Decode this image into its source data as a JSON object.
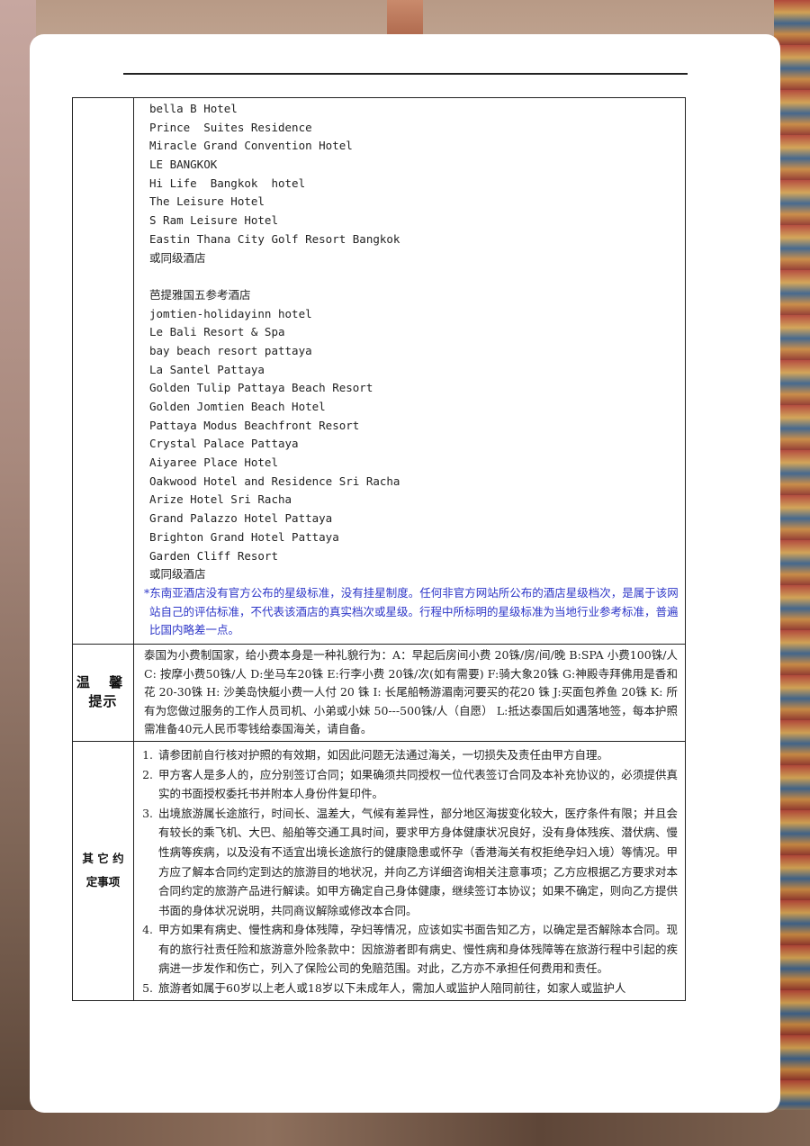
{
  "hotels_group1": [
    "bella B Hotel",
    "Prince  Suites Residence",
    "Miracle Grand Convention Hotel",
    "LE BANGKOK",
    "Hi Life  Bangkok  hotel",
    "The Leisure Hotel",
    "S Ram Leisure Hotel",
    "Eastin Thana City Golf Resort Bangkok",
    "或同级酒店"
  ],
  "pattaya_heading": "芭提雅国五参考酒店",
  "hotels_group2": [
    "jomtien-holidayinn hotel",
    "Le Bali Resort & Spa",
    "bay beach resort pattaya",
    "La Santel Pattaya",
    "Golden Tulip Pattaya Beach Resort",
    "Golden Jomtien Beach Hotel",
    "Pattaya Modus Beachfront Resort",
    "Crystal Palace Pattaya",
    "Aiyaree Place Hotel",
    "Oakwood Hotel and Residence Sri Racha",
    "Arize Hotel Sri Racha",
    "Grand Palazzo Hotel Pattaya",
    "Brighton Grand Hotel Pattaya",
    "Garden Cliff Resort",
    "或同级酒店"
  ],
  "star_note": "*东南亚酒店没有官方公布的星级标准，没有挂星制度。任何非官方网站所公布的酒店星级档次，是属于该网站自己的评估标准，不代表该酒店的真实档次或星级。行程中所标明的星级标准为当地行业参考标准，普遍比国内略差一点。",
  "tips": {
    "label_line1": "温 馨",
    "label_line2": "提示",
    "text": "泰国为小费制国家，给小费本身是一种礼貌行为：A：早起后房间小费 20铢/房/间/晚  B:SPA 小费100铢/人  C: 按摩小费50铢/人 D:坐马车20铢  E:行李小费 20铢/次(如有需要)  F:骑大象20铢 G:神殿寺拜佛用是香和花 20-30铢 H: 沙美岛快艇小费一人付 20 铢 I: 长尾船畅游湄南河要买的花20 铢 J:买面包养鱼 20铢 K: 所有为您做过服务的工作人员司机、小弟或小妹 50---500铢/人（自愿）  L:抵达泰国后如遇落地签，每本护照需准备40元人民币零钱给泰国海关，请自备。"
  },
  "other": {
    "label_line1": "其 它 约",
    "label_line2": "定事项",
    "items": [
      {
        "num": "1.",
        "text": "请参团前自行核对护照的有效期，如因此问题无法通过海关，一切损失及责任由甲方自理。"
      },
      {
        "num": "2.",
        "text": "甲方客人是多人的，应分别签订合同；如果确须共同授权一位代表签订合同及本补充协议的，必须提供真实的书面授权委托书并附本人身份件复印件。"
      },
      {
        "num": "3.",
        "text": "出境旅游属长途旅行，时间长、温差大，气候有差异性，部分地区海拔变化较大，医疗条件有限；并且会有较长的乘飞机、大巴、船舶等交通工具时间，要求甲方身体健康状况良好，没有身体残疾、潜伏病、慢性病等疾病，以及没有不适宜出境长途旅行的健康隐患或怀孕（香港海关有权拒绝孕妇入境）等情况。甲方应了解本合同约定到达的旅游目的地状况，并向乙方详细咨询相关注意事项；乙方应根据乙方要求对本合同约定的旅游产品进行解读。如甲方确定自己身体健康，继续签订本协议；如果不确定，则向乙方提供书面的身体状况说明，共同商议解除或修改本合同。"
      },
      {
        "num": "4.",
        "text": "甲方如果有病史、慢性病和身体残障，孕妇等情况，应该如实书面告知乙方，以确定是否解除本合同。现有的旅行社责任险和旅游意外险条款中：因旅游者即有病史、慢性病和身体残障等在旅游行程中引起的疾病进一步发作和伤亡，列入了保险公司的免赔范围。对此，乙方亦不承担任何费用和责任。"
      },
      {
        "num": "5.",
        "text": "旅游者如属于60岁以上老人或18岁以下未成年人，需加人或监护人陪同前往，如家人或监护人"
      }
    ]
  }
}
